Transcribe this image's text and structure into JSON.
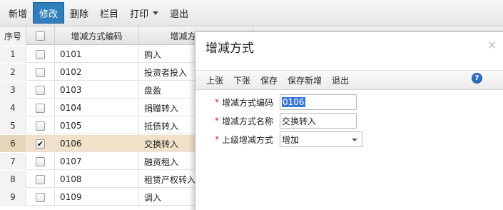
{
  "toolbar": {
    "items": [
      {
        "label": "新增"
      },
      {
        "label": "修改"
      },
      {
        "label": "删除"
      },
      {
        "label": "栏目"
      },
      {
        "label": "打印"
      },
      {
        "label": "退出"
      }
    ]
  },
  "grid": {
    "headers": {
      "index": "序号",
      "code": "增减方式编码",
      "name": "增减方式名称"
    },
    "rows": [
      {
        "index": "1",
        "code": "0101",
        "name": "购入",
        "checked": false
      },
      {
        "index": "2",
        "code": "0102",
        "name": "投资者投入",
        "checked": false
      },
      {
        "index": "3",
        "code": "0103",
        "name": "盘盈",
        "checked": false
      },
      {
        "index": "4",
        "code": "0104",
        "name": "捐赠转入",
        "checked": false
      },
      {
        "index": "5",
        "code": "0105",
        "name": "抵债转入",
        "checked": false
      },
      {
        "index": "6",
        "code": "0106",
        "name": "交换转入",
        "checked": true
      },
      {
        "index": "7",
        "code": "0107",
        "name": "融资租入",
        "checked": false
      },
      {
        "index": "8",
        "code": "0108",
        "name": "租赁产权转入",
        "checked": false
      },
      {
        "index": "9",
        "code": "0109",
        "name": "调入",
        "checked": false
      }
    ]
  },
  "dialog": {
    "title": "增减方式",
    "close": "×",
    "toolbar": [
      "上张",
      "下张",
      "保存",
      "保存新增",
      "退出"
    ],
    "help": "?",
    "fields": {
      "required_mark": "*",
      "code_label": "增减方式编码",
      "code_value": "0106",
      "name_label": "增减方式名称",
      "name_value": "交换转入",
      "parent_label": "上级增减方式",
      "parent_value": "增加"
    }
  }
}
